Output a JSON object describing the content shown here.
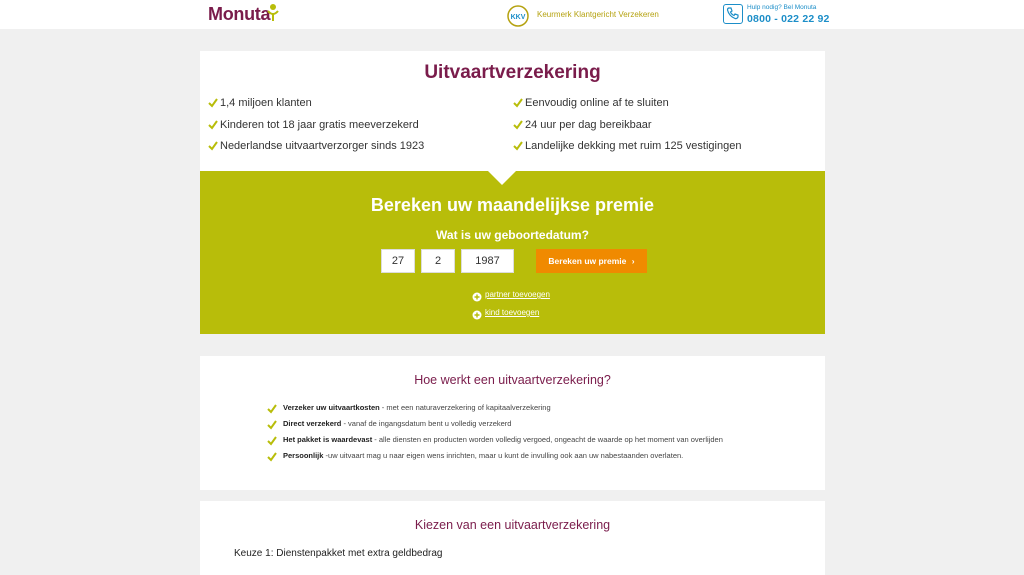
{
  "header": {
    "logo": "Monuta",
    "kkv_badge": "KKV",
    "kkv_text": "Keurmerk Klantgericht Verzekeren",
    "help_text": "Hulp nodig? Bel Monuta",
    "phone": "0800 - 022 22 92"
  },
  "hero": {
    "title": "Uitvaartverzekering",
    "usps_left": [
      "1,4 miljoen klanten",
      "Kinderen tot 18 jaar gratis meeverzekerd",
      "Nederlandse uitvaartverzorger sinds 1923"
    ],
    "usps_right": [
      "Eenvoudig online af te sluiten",
      "24 uur per dag bereikbaar",
      "Landelijke dekking met ruim 125 vestigingen"
    ]
  },
  "calculator": {
    "title": "Bereken uw maandelijkse premie",
    "question": "Wat is uw geboortedatum?",
    "day": "27",
    "month": "2",
    "year": "1987",
    "button": "Bereken uw premie",
    "button_icon": "chevron-right-icon",
    "add_partner": "partner toevoegen",
    "add_child": "kind toevoegen"
  },
  "how": {
    "title": "Hoe werkt een uitvaartverzekering?",
    "items": [
      {
        "bold": "Verzeker uw uitvaartkosten",
        "text": " - met een naturaverzekering of kapitaalverzekering"
      },
      {
        "bold": "Direct verzekerd",
        "text": " - vanaf de ingangsdatum bent u volledig verzekerd"
      },
      {
        "bold": "Het pakket is waardevast",
        "text": " - alle diensten en producten worden volledig vergoed, ongeacht de waarde op het moment van overlijden"
      },
      {
        "bold": "Persoonlijk",
        "text": " -uw uitvaart mag u naar eigen wens inrichten, maar u kunt de invulling ook aan uw nabestaanden overlaten."
      }
    ]
  },
  "choose": {
    "title": "Kiezen van een uitvaartverzekering",
    "option1": "Keuze 1: Dienstenpakket met extra geldbedrag"
  },
  "colors": {
    "brand": "#7a1c4b",
    "green": "#b8bd0a",
    "orange": "#f08a00",
    "blue": "#1c8ec8"
  }
}
